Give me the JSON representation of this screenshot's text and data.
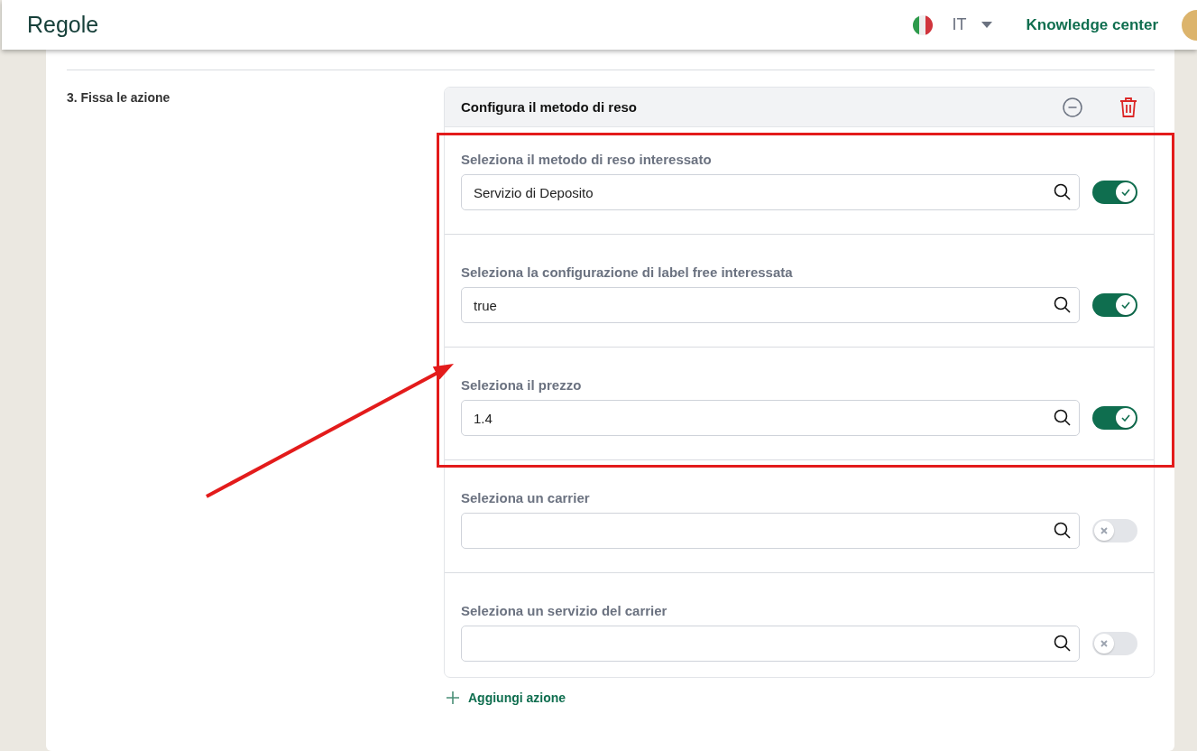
{
  "header": {
    "title": "Regole",
    "language": "IT",
    "link": "Knowledge center"
  },
  "section": {
    "label": "3. Fissa le azione"
  },
  "action": {
    "title": "Configura il metodo di reso",
    "fields": [
      {
        "label": "Seleziona il metodo di reso interessato",
        "value": "Servizio di Deposito",
        "on": true
      },
      {
        "label": "Seleziona la configurazione di label free interessata",
        "value": "true",
        "on": true
      },
      {
        "label": "Seleziona il prezzo",
        "value": "1.4",
        "on": true
      },
      {
        "label": "Seleziona un carrier",
        "on": false
      },
      {
        "label": "Seleziona un servizio del carrier",
        "on": false
      }
    ]
  },
  "add_action": "Aggiungi azione"
}
